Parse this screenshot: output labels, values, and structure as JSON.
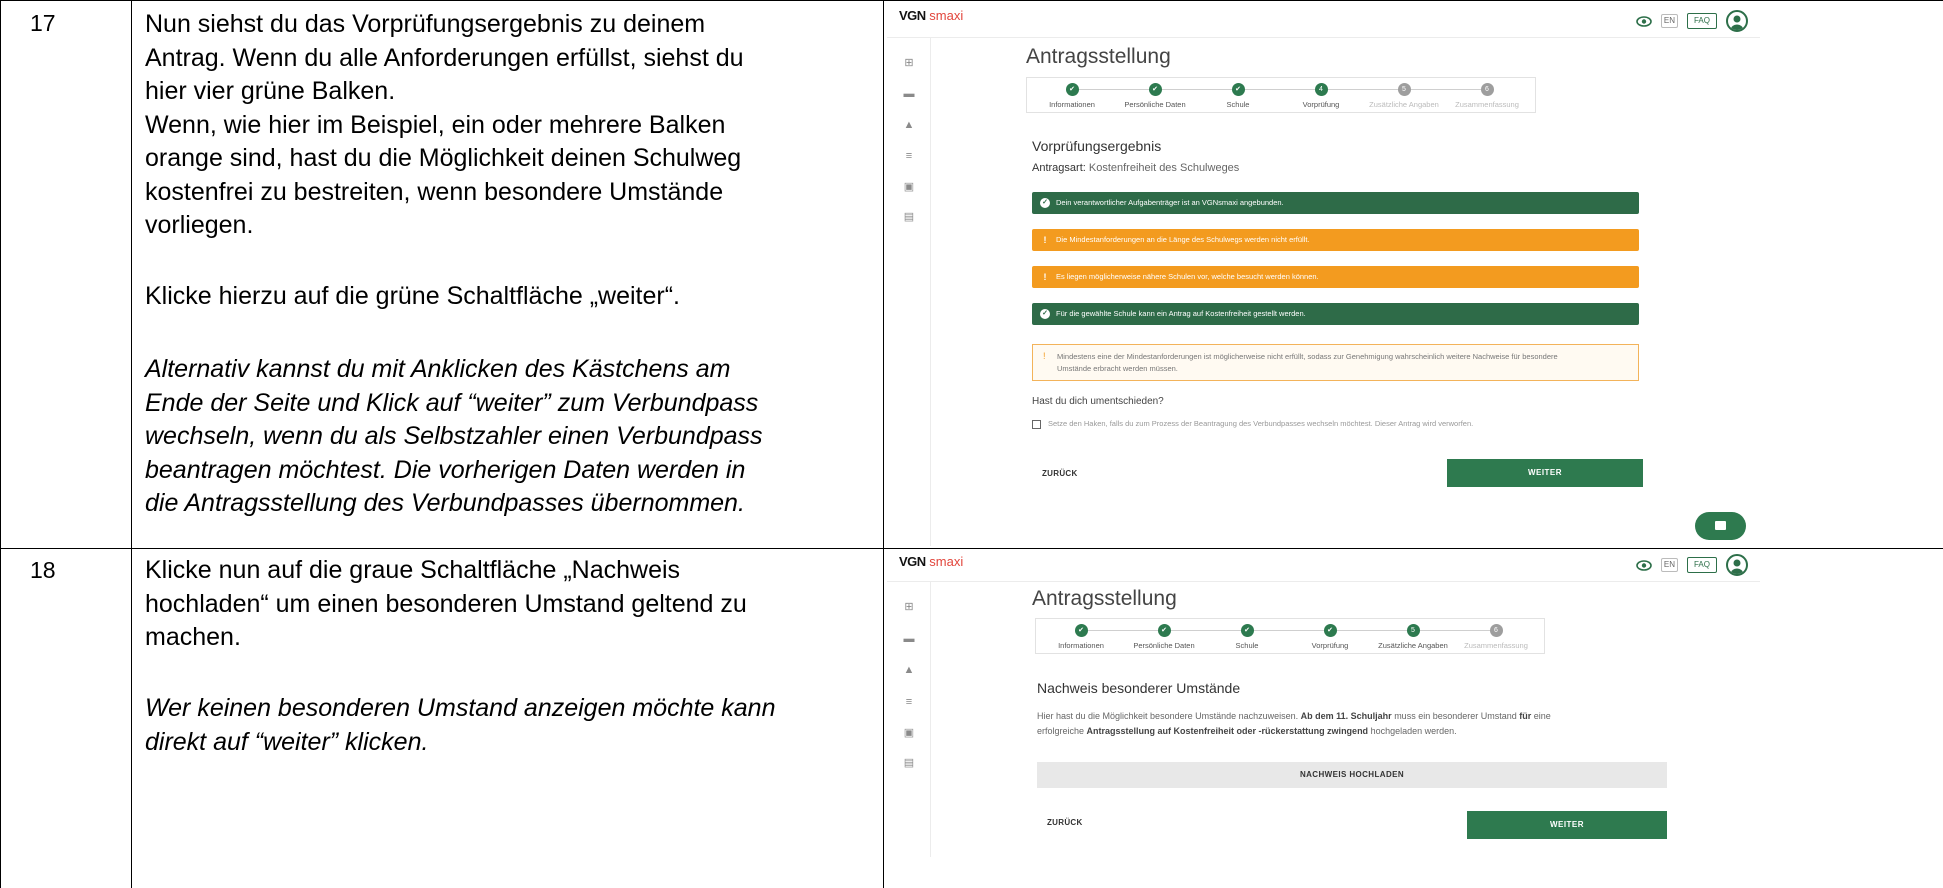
{
  "rows": [
    {
      "number": "17",
      "instructions": {
        "p1": [
          "Nun siehst du das Vorprüfungsergebnis zu deinem",
          "Antrag. Wenn du alle Anforderungen erfüllst, siehst du",
          "hier vier grüne Balken."
        ],
        "p2": [
          "Wenn, wie hier im Beispiel, ein oder mehrere Balken",
          "orange sind, hast du die Möglichkeit deinen Schulweg",
          "kostenfrei zu bestreiten, wenn besondere Umstände",
          "vorliegen."
        ],
        "p3": "Klicke hierzu auf die grüne Schaltfläche „weiter“.",
        "p4_italic": [
          "Alternativ kannst du mit Anklicken des Kästchens am",
          "Ende der Seite und Klick auf “weiter” zum Verbundpass",
          "wechseln, wenn du als Selbstzahler einen Verbundpass",
          "beantragen möchtest. Die vorherigen Daten werden in",
          "die Antragsstellung des Verbundpasses übernommen."
        ]
      },
      "screenshot": {
        "logo_vgn": "VGN",
        "logo_smaxi": "smaxi",
        "lang_button": "EN",
        "faq_button": "FAQ",
        "page_title": "Antragsstellung",
        "steps": [
          {
            "label": "Informationen",
            "state": "done",
            "icon": "✔"
          },
          {
            "label": "Persönliche Daten",
            "state": "done",
            "icon": "✔"
          },
          {
            "label": "Schule",
            "state": "done",
            "icon": "✔"
          },
          {
            "label": "Vorprüfung",
            "state": "current",
            "icon": "4"
          },
          {
            "label": "Zusätzliche Angaben",
            "state": "todo",
            "icon": "5"
          },
          {
            "label": "Zusammenfassung",
            "state": "todo",
            "icon": "6"
          }
        ],
        "section_title": "Vorprüfungsergebnis",
        "antragsart_label": "Antragsart:",
        "antragsart_value": "Kostenfreiheit des Schulweges",
        "bars": [
          {
            "color": "green",
            "text": "Dein verantwortlicher Aufgabenträger ist an VGNsmaxi angebunden."
          },
          {
            "color": "orange",
            "text": "Die Mindestanforderungen an die Länge des Schulwegs werden nicht erfüllt."
          },
          {
            "color": "orange",
            "text": "Es liegen möglicherweise nähere Schulen vor, welche besucht werden können."
          },
          {
            "color": "green",
            "text": "Für die gewählte Schule kann ein Antrag auf Kostenfreiheit gestellt werden."
          }
        ],
        "note_lines": [
          "Mindestens eine der Mindestanforderungen ist möglicherweise nicht erfüllt, sodass zur Genehmigung wahrscheinlich weitere Nachweise für besondere",
          "Umstände erbracht werden müssen."
        ],
        "question": "Hast du dich umentschieden?",
        "checkbox_label": "Setze den Haken, falls du zum Prozess der Beantragung des Verbundpasses wechseln möchtest. Dieser Antrag wird verworfen.",
        "back_button": "ZURÜCK",
        "next_button": "WEITER",
        "colors": {
          "green": "#2e6b48",
          "orange": "#f39b1f",
          "brand_red": "#e2463c"
        }
      }
    },
    {
      "number": "18",
      "instructions": {
        "p1": [
          "Klicke nun auf die graue Schaltfläche „Nachweis",
          "hochladen“ um einen besonderen Umstand geltend zu",
          "machen."
        ],
        "p2_italic": [
          "Wer keinen besonderen Umstand anzeigen möchte kann",
          "direkt auf “weiter” klicken."
        ]
      },
      "screenshot": {
        "logo_vgn": "VGN",
        "logo_smaxi": "smaxi",
        "lang_button": "EN",
        "faq_button": "FAQ",
        "page_title": "Antragsstellung",
        "steps": [
          {
            "label": "Informationen",
            "state": "done",
            "icon": "✔"
          },
          {
            "label": "Persönliche Daten",
            "state": "done",
            "icon": "✔"
          },
          {
            "label": "Schule",
            "state": "done",
            "icon": "✔"
          },
          {
            "label": "Vorprüfung",
            "state": "done",
            "icon": "✔"
          },
          {
            "label": "Zusätzliche Angaben",
            "state": "current",
            "icon": "5"
          },
          {
            "label": "Zusammenfassung",
            "state": "todo",
            "icon": "6"
          }
        ],
        "section_title": "Nachweis besonderer Umstände",
        "para_1a": "Hier hast du die Möglichkeit besondere Umstände nachzuweisen. ",
        "para_1b": "Ab dem 11. Schuljahr",
        "para_1c": " muss ein besonderer Umstand ",
        "para_1d": "für",
        "para_1e": " eine",
        "para_2a": "erfolgreiche ",
        "para_2b": "Antragsstellung auf Kostenfreiheit oder -rückerstattung zwingend",
        "para_2c": " hochgeladen werden.",
        "upload_button": "NACHWEIS HOCHLADEN",
        "back_button": "ZURÜCK",
        "next_button": "WEITER"
      }
    }
  ]
}
